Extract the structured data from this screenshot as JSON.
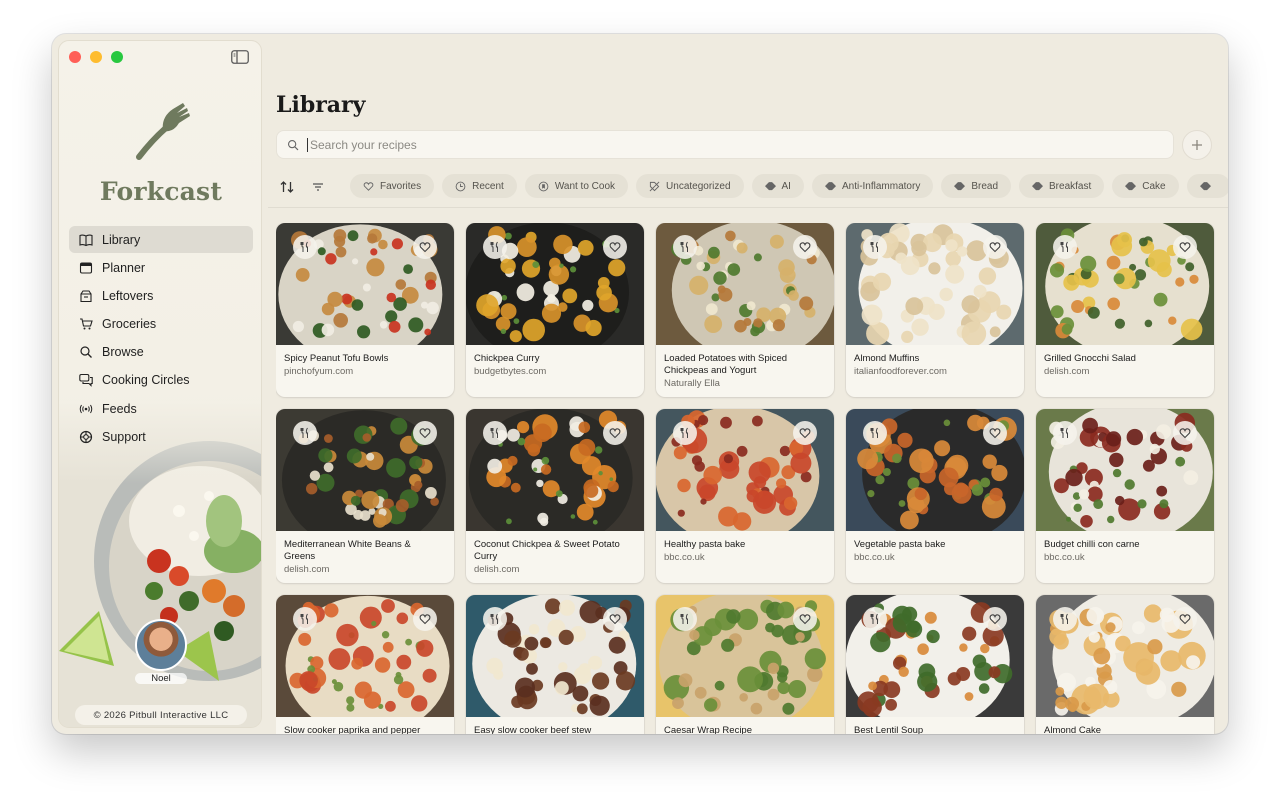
{
  "window_controls": [
    "close",
    "minimize",
    "zoom"
  ],
  "sidebar": {
    "brand": "Forkcast",
    "nav": [
      {
        "label": "Library",
        "icon": "book-icon",
        "active": true
      },
      {
        "label": "Planner",
        "icon": "calendar-icon"
      },
      {
        "label": "Leftovers",
        "icon": "leftovers-icon"
      },
      {
        "label": "Groceries",
        "icon": "cart-icon"
      },
      {
        "label": "Browse",
        "icon": "search-icon"
      },
      {
        "label": "Cooking Circles",
        "icon": "chat-bubbles-icon"
      },
      {
        "label": "Feeds",
        "icon": "broadcast-icon"
      },
      {
        "label": "Support",
        "icon": "lifebuoy-icon"
      }
    ],
    "user_name": "Noel",
    "copyright": "© 2026 Pitbull Interactive LLC"
  },
  "main": {
    "title": "Library",
    "search_placeholder": "Search your recipes",
    "chips": [
      {
        "label": "Favorites",
        "icon": "heart-icon"
      },
      {
        "label": "Recent",
        "icon": "clock-icon"
      },
      {
        "label": "Want to Cook",
        "icon": "bookmark-icon"
      },
      {
        "label": "Uncategorized",
        "icon": "tag-off-icon"
      },
      {
        "label": "AI",
        "icon": "tag-icon"
      },
      {
        "label": "Anti-Inflammatory",
        "icon": "tag-icon"
      },
      {
        "label": "Bread",
        "icon": "tag-icon"
      },
      {
        "label": "Breakfast",
        "icon": "tag-icon"
      },
      {
        "label": "Cake",
        "icon": "tag-icon"
      },
      {
        "label": "",
        "icon": "tag-icon"
      }
    ],
    "recipes": [
      {
        "title": "Spicy Peanut Tofu Bowls",
        "source": "pinchofyum.com"
      },
      {
        "title": "Chickpea Curry",
        "source": "budgetbytes.com"
      },
      {
        "title": "Loaded Potatoes with Spiced Chickpeas and Yogurt",
        "source": "Naturally Ella"
      },
      {
        "title": "Almond Muffins",
        "source": "italianfoodforever.com"
      },
      {
        "title": "Grilled Gnocchi Salad",
        "source": "delish.com"
      },
      {
        "title": "Mediterranean White Beans & Greens",
        "source": "delish.com"
      },
      {
        "title": "Coconut Chickpea & Sweet Potato Curry",
        "source": "delish.com"
      },
      {
        "title": "Healthy pasta bake",
        "source": "bbc.co.uk"
      },
      {
        "title": "Vegetable pasta bake",
        "source": "bbc.co.uk"
      },
      {
        "title": "Budget chilli con carne",
        "source": "bbc.co.uk"
      },
      {
        "title": "Slow cooker paprika and pepper",
        "source": ""
      },
      {
        "title": "Easy slow cooker beef stew",
        "source": ""
      },
      {
        "title": "Caesar Wrap Recipe",
        "source": ""
      },
      {
        "title": "Best Lentil Soup",
        "source": ""
      },
      {
        "title": "Almond Cake",
        "source": ""
      }
    ]
  }
}
